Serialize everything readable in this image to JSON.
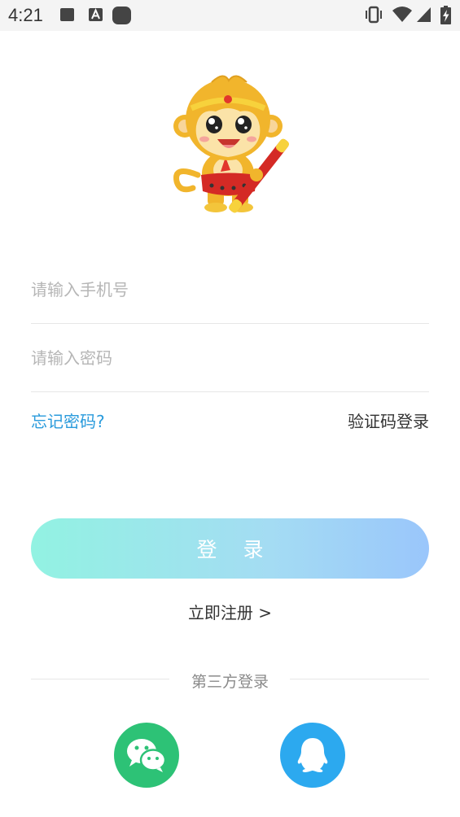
{
  "status_bar": {
    "time": "4:21",
    "icons": [
      "notification-square-icon",
      "font-a-icon",
      "rounded-square-icon",
      "vibrate-icon",
      "wifi-icon",
      "signal-icon",
      "battery-charging-icon"
    ]
  },
  "mascot": {
    "name": "monkey-king-mascot"
  },
  "form": {
    "phone_placeholder": "请输入手机号",
    "password_placeholder": "请输入密码"
  },
  "links": {
    "forgot_password": "忘记密码?",
    "code_login": "验证码登录"
  },
  "login_button": "登 录",
  "register": "立即注册  >",
  "third_party": {
    "label": "第三方登录",
    "providers": [
      "wechat",
      "qq"
    ]
  },
  "colors": {
    "link_blue": "#2a9bdc",
    "gradient_start": "#92f2e2",
    "gradient_end": "#9ac6fb",
    "wechat_green": "#2dc276",
    "qq_blue": "#2ca9ef"
  }
}
